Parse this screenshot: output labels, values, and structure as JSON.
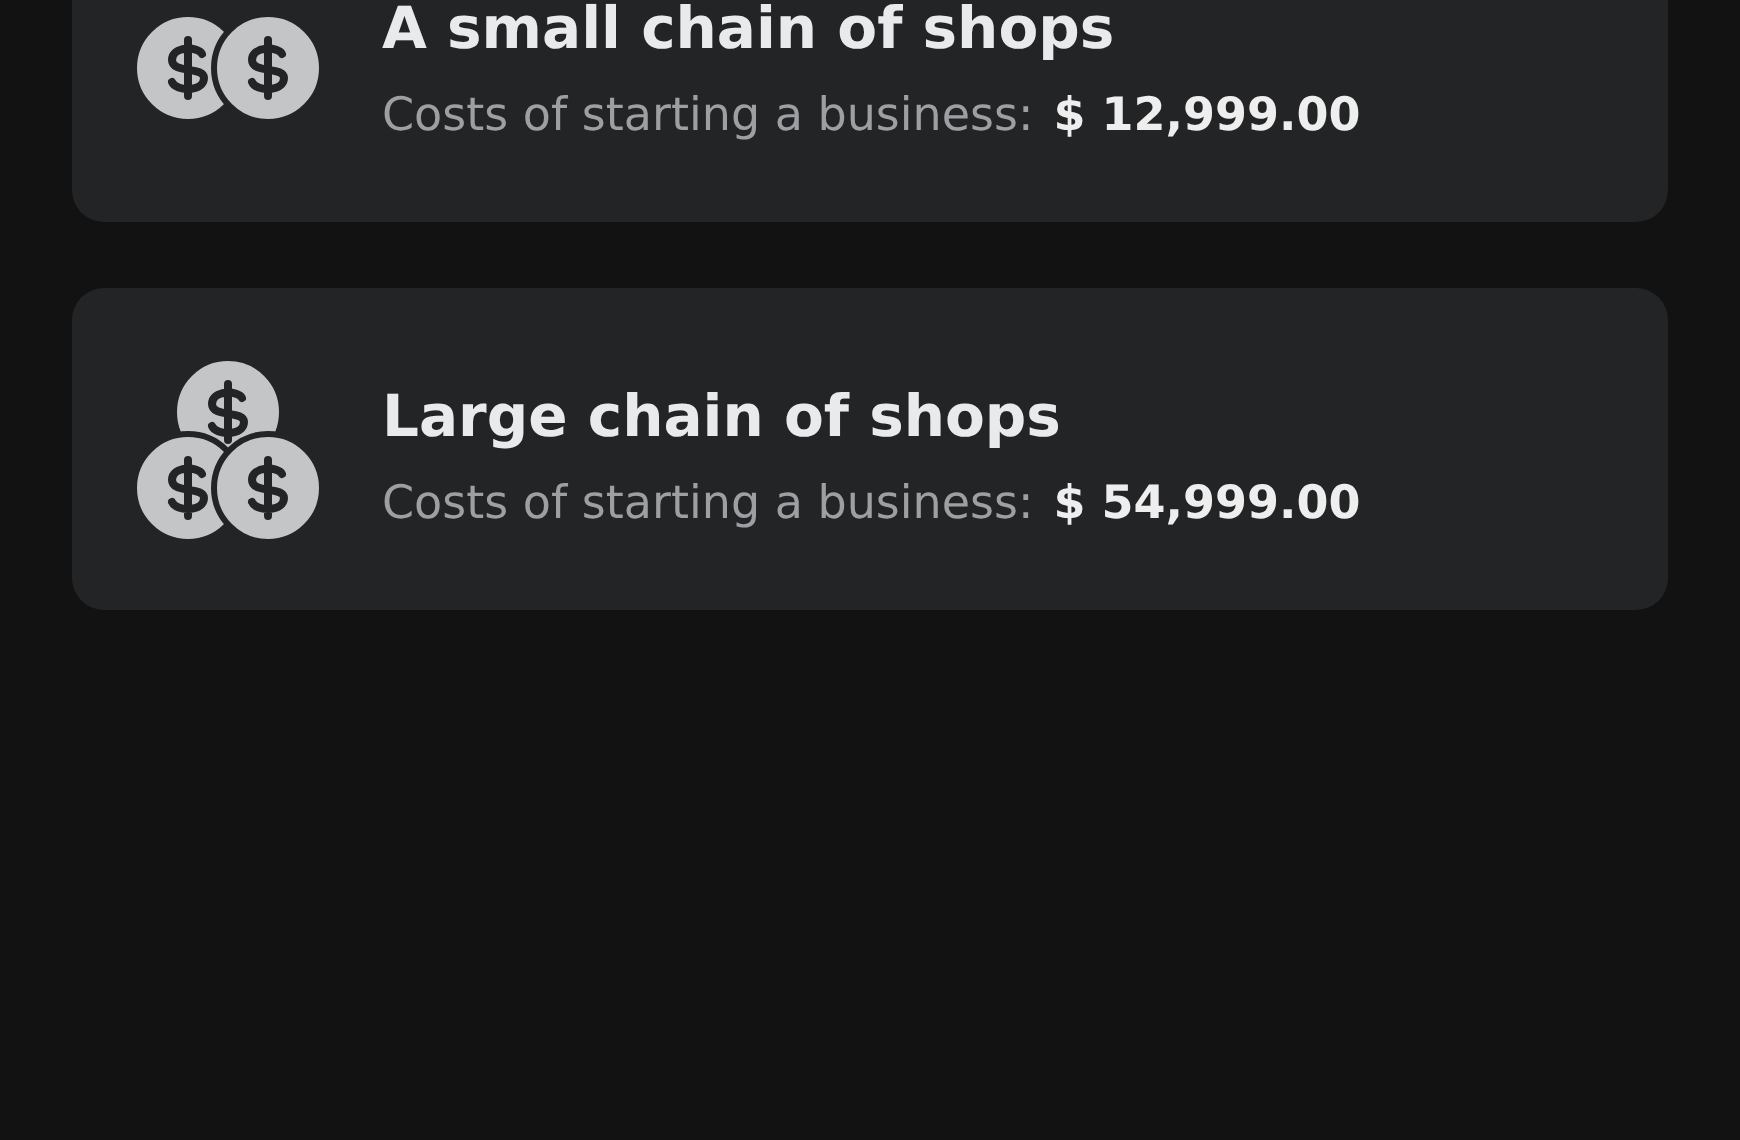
{
  "plans": [
    {
      "icon": {
        "kind": "pair"
      },
      "title": "A small chain of shops",
      "cost_label": "Costs of starting a business:",
      "cost": "$ 12,999.00"
    },
    {
      "icon": {
        "kind": "stack"
      },
      "title": "Large chain of shops",
      "cost_label": "Costs of starting a business:",
      "cost": "$ 54,999.00"
    }
  ]
}
